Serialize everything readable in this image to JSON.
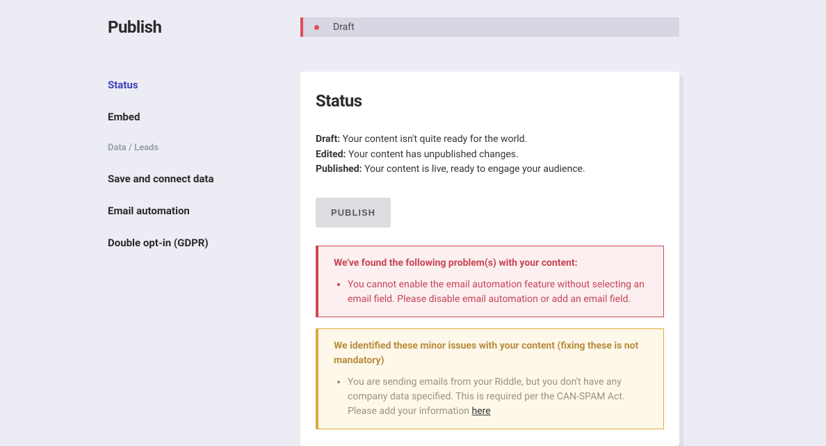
{
  "sidebar": {
    "title": "Publish",
    "items": [
      {
        "label": "Status",
        "active": true
      },
      {
        "label": "Embed",
        "active": false
      }
    ],
    "groupLabel": "Data / Leads",
    "groupItems": [
      {
        "label": "Save and connect data"
      },
      {
        "label": "Email automation"
      },
      {
        "label": "Double opt-in (GDPR)"
      }
    ]
  },
  "banner": {
    "label": "Draft"
  },
  "card": {
    "heading": "Status",
    "lines": {
      "draft": {
        "label": "Draft:",
        "text": "Your content isn't quite ready for the world."
      },
      "edited": {
        "label": "Edited:",
        "text": "Your content has unpublished changes."
      },
      "published": {
        "label": "Published:",
        "text": "Your content is live, ready to engage your audience."
      }
    },
    "publishButton": "PUBLISH"
  },
  "alerts": {
    "error": {
      "title": "We've found the following problem(s) with your content:",
      "item": "You cannot enable the email automation feature without selecting an email field. Please disable email automation or add an email field."
    },
    "warning": {
      "title": "We identified these minor issues with your content (fixing these is not mandatory)",
      "itemPrefix": "You are sending emails from your Riddle, but you don't have any company data specified. This is required per the CAN-SPAM Act. Please add your information ",
      "linkText": "here"
    }
  }
}
